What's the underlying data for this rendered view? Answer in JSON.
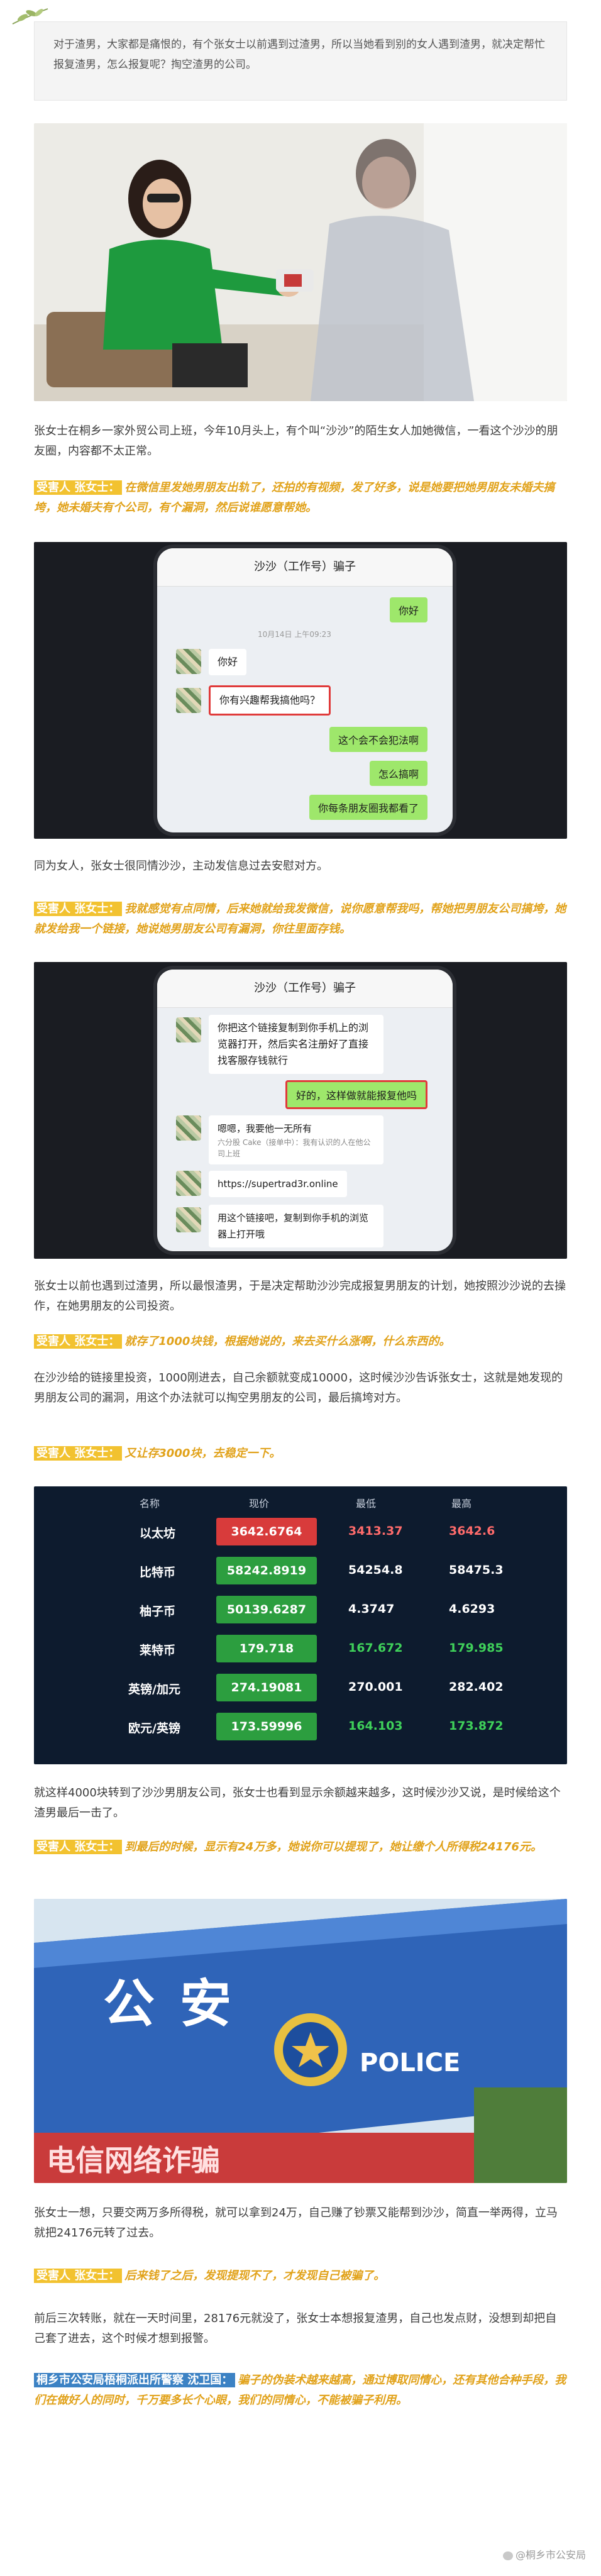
{
  "intro": "对于渣男，大家都是痛恨的，有个张女士以前遇到过渣男，所以当她看到别的女人遇到渣男，就决定帮忙报复渣男，怎么报复呢？掏空渣男的公司。",
  "para1": "张女士在桐乡一家外贸公司上班，今年10月头上，有个叫“沙沙”的陌生女人加她微信，一看这个沙沙的朋友圈，内容都不太正常。",
  "quote1": {
    "tag": "受害人 张女士：",
    "text": "在微信里发她男朋友出轨了，还拍的有视频，发了好多，说是她要把她男朋友未婚夫搞垮，她未婚夫有个公司，有个漏洞，然后说谁愿意帮她。"
  },
  "chat1": {
    "title": "沙沙（工作号）骗子",
    "time": "10月14日 上午09:23",
    "messages": [
      {
        "side": "right",
        "text": "你好"
      },
      {
        "side": "left",
        "text": "你好"
      },
      {
        "side": "left",
        "text": "你有兴趣帮我搞他吗？"
      },
      {
        "side": "right",
        "text": "这个会不会犯法啊"
      },
      {
        "side": "right",
        "text": "怎么搞啊"
      },
      {
        "side": "right",
        "text": "你每条朋友圈我都看了"
      }
    ]
  },
  "para2": "同为女人，张女士很同情沙沙，主动发信息过去安慰对方。",
  "quote2": {
    "tag": "受害人 张女士：",
    "text": "我就感觉有点同情，后来她就给我发微信，说你愿意帮我吗，帮她把男朋友公司搞垮，她就发给我一个链接，她说她男朋友公司有漏洞，你往里面存钱。"
  },
  "chat2": {
    "title": "沙沙（工作号）骗子",
    "messages": [
      {
        "side": "left",
        "text": "你把这个链接复制到你手机上的浏览器打开，然后实名注册好了直接找客服存钱就行"
      },
      {
        "side": "right",
        "text": "好的，这样做就能报复他吗"
      },
      {
        "side": "left",
        "text": "嗯嗯，我要他一无所有"
      },
      {
        "side": "left",
        "text": "六分股 Cake（接单中）：我有认识的人在他公司上班"
      },
      {
        "side": "left",
        "text": "https://supertrad3r.online"
      },
      {
        "side": "left",
        "text": "用这个链接吧，复制到你手机的浏览器上打开哦"
      }
    ]
  },
  "para3": "张女士以前也遇到过渣男，所以最恨渣男，于是决定帮助沙沙完成报复男朋友的计划，她按照沙沙说的去操作，在她男朋友的公司投资。",
  "quote3": {
    "tag": "受害人 张女士：",
    "text": "就存了1000块钱，根据她说的，来去买什么涨啊，什么东西的。"
  },
  "para4": "在沙沙给的链接里投资，1000刚进去，自己余额就变成10000，这时候沙沙告诉张女士，这就是她发现的男朋友公司的漏洞，用这个办法就可以掏空男朋友的公司，最后搞垮对方。",
  "quote4": {
    "tag": "受害人 张女士：",
    "text": "又让存3000块，去稳定一下。"
  },
  "stocks": {
    "headers": [
      "名称",
      "现价",
      "最低",
      "最高"
    ],
    "rows": [
      {
        "name": "以太坊",
        "price": "3642.6764",
        "low": "3413.37",
        "high": "3642.6",
        "trend": "red"
      },
      {
        "name": "比特币",
        "price": "58242.8919",
        "low": "54254.8",
        "high": "58475.3",
        "trend": "green"
      },
      {
        "name": "柚子币",
        "price": "50139.6287",
        "low": "4.3747",
        "high": "4.6293",
        "trend": "green"
      },
      {
        "name": "莱特币",
        "price": "179.718",
        "low": "167.672",
        "high": "179.985",
        "trend": "green"
      },
      {
        "name": "英镑/加元",
        "price": "274.19081",
        "low": "270.001",
        "high": "282.402",
        "trend": "green"
      },
      {
        "name": "欧元/英镑",
        "price": "173.59996",
        "low": "164.103",
        "high": "173.872",
        "trend": "green"
      }
    ]
  },
  "para5": "就这样4000块转到了沙沙男朋友公司，张女士也看到显示余额越来越多，这时候沙沙又说，是时候给这个渣男最后一击了。",
  "quote5": {
    "tag": "受害人 张女士：",
    "text": "到最后的时候，显示有24万多，她说你可以提现了，她让缴个人所得税24176元。"
  },
  "police": {
    "sign": "公安",
    "police_word": "POLICE",
    "banner": "电信网络诈骗"
  },
  "para6": "张女士一想，只要交两万多所得税，就可以拿到24万，自己赚了钞票又能帮到沙沙，简直一举两得，立马就把24176元转了过去。",
  "quote6": {
    "tag": "受害人 张女士：",
    "text": "后来钱了之后，发现提现不了，才发现自己被骗了。"
  },
  "para7": "前后三次转账，就在一天时间里，28176元就没了，张女士本想报复渣男，自己也发点财，没想到却把自己套了进去，这个时候才想到报警。",
  "quote7": {
    "tag": "桐乡市公安局梧桐派出所警察 沈卫国：",
    "text": "骗子的伪装术越来越高，通过博取同情心，还有其他合种手段，我们在做好人的同时，千万要多长个心眼，我们的同情心，不能被骗子利用。"
  },
  "watermark": "@桐乡市公安局"
}
